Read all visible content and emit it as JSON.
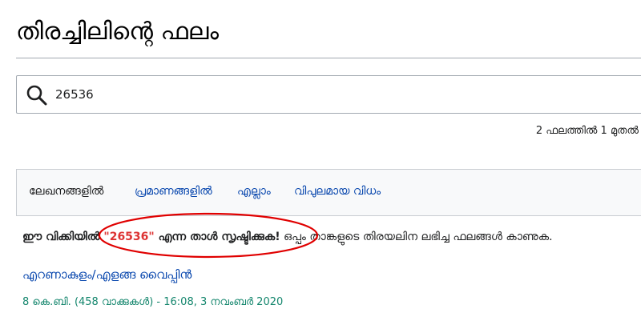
{
  "header": {
    "title": "തിരച്ചിലിന്റെ ഫലം"
  },
  "search": {
    "value": "26536",
    "icon": "search-icon"
  },
  "results_info": {
    "count_text": "2 ഫലത്തിൽ 1 മുതൽ"
  },
  "filters": {
    "items": [
      {
        "label": "ലേഖനങ്ങളിൽ",
        "selected": true
      },
      {
        "label": "പ്രമാണങ്ങളിൽ",
        "selected": false
      },
      {
        "label": "എല്ലാം",
        "selected": false
      },
      {
        "label": "വിപുലമായ വിധം",
        "selected": false
      }
    ]
  },
  "notice": {
    "prefix": "ഈ വിക്കിയിൽ ",
    "link_text": "\"26536\"",
    "suffix_bold": " എന്ന താൾ സൃഷ്ടിക്കുക!",
    "suffix": " ഒപ്പം താങ്കളുടെ തിരയലിന ലഭിച്ച ഫലങ്ങൾ കാണുക."
  },
  "results": [
    {
      "title": "എറണാകുളം/എളങ്ങ വൈപ്പിൻ",
      "meta": "8 കെ.ബി. (458 വാക്കുകൾ) - 16:08, 3 നവംബർ 2020"
    }
  ],
  "colors": {
    "link": "#0645ad",
    "red_link": "#dd3333",
    "meta_green": "#14866d",
    "annotation_red": "#e00000"
  }
}
